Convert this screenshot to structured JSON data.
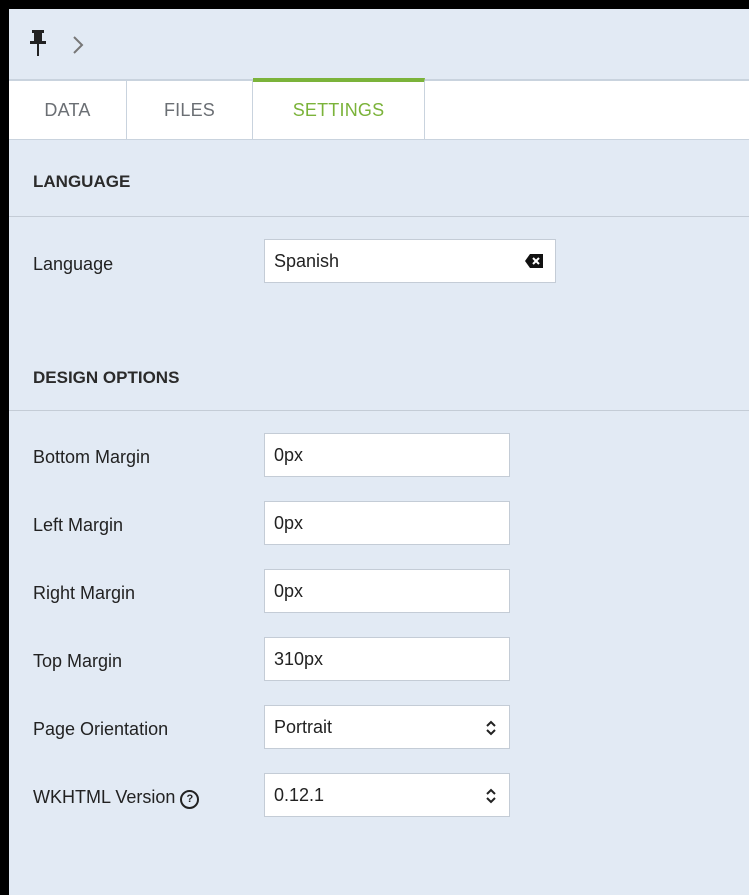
{
  "tabs": [
    {
      "label": "DATA"
    },
    {
      "label": "FILES"
    },
    {
      "label": "SETTINGS"
    }
  ],
  "language_section": {
    "title": "LANGUAGE",
    "language_label": "Language",
    "language_value": "Spanish"
  },
  "design_section": {
    "title": "DESIGN OPTIONS",
    "fields": [
      {
        "label": "Bottom Margin",
        "value": "0px"
      },
      {
        "label": "Left Margin",
        "value": "0px"
      },
      {
        "label": "Right Margin",
        "value": "0px"
      },
      {
        "label": "Top Margin",
        "value": "310px"
      },
      {
        "label": "Page Orientation",
        "value": "Portrait"
      },
      {
        "label": "WKHTML Version",
        "value": "0.12.1"
      }
    ],
    "help_glyph": "?"
  },
  "colors": {
    "accent": "#7bb33a",
    "panel_bg": "#e2eaf4",
    "border": "#c9d3de"
  },
  "icons": [
    "pin-icon",
    "chevron-right-icon",
    "clear-icon",
    "select-arrows-icon",
    "help-icon"
  ]
}
